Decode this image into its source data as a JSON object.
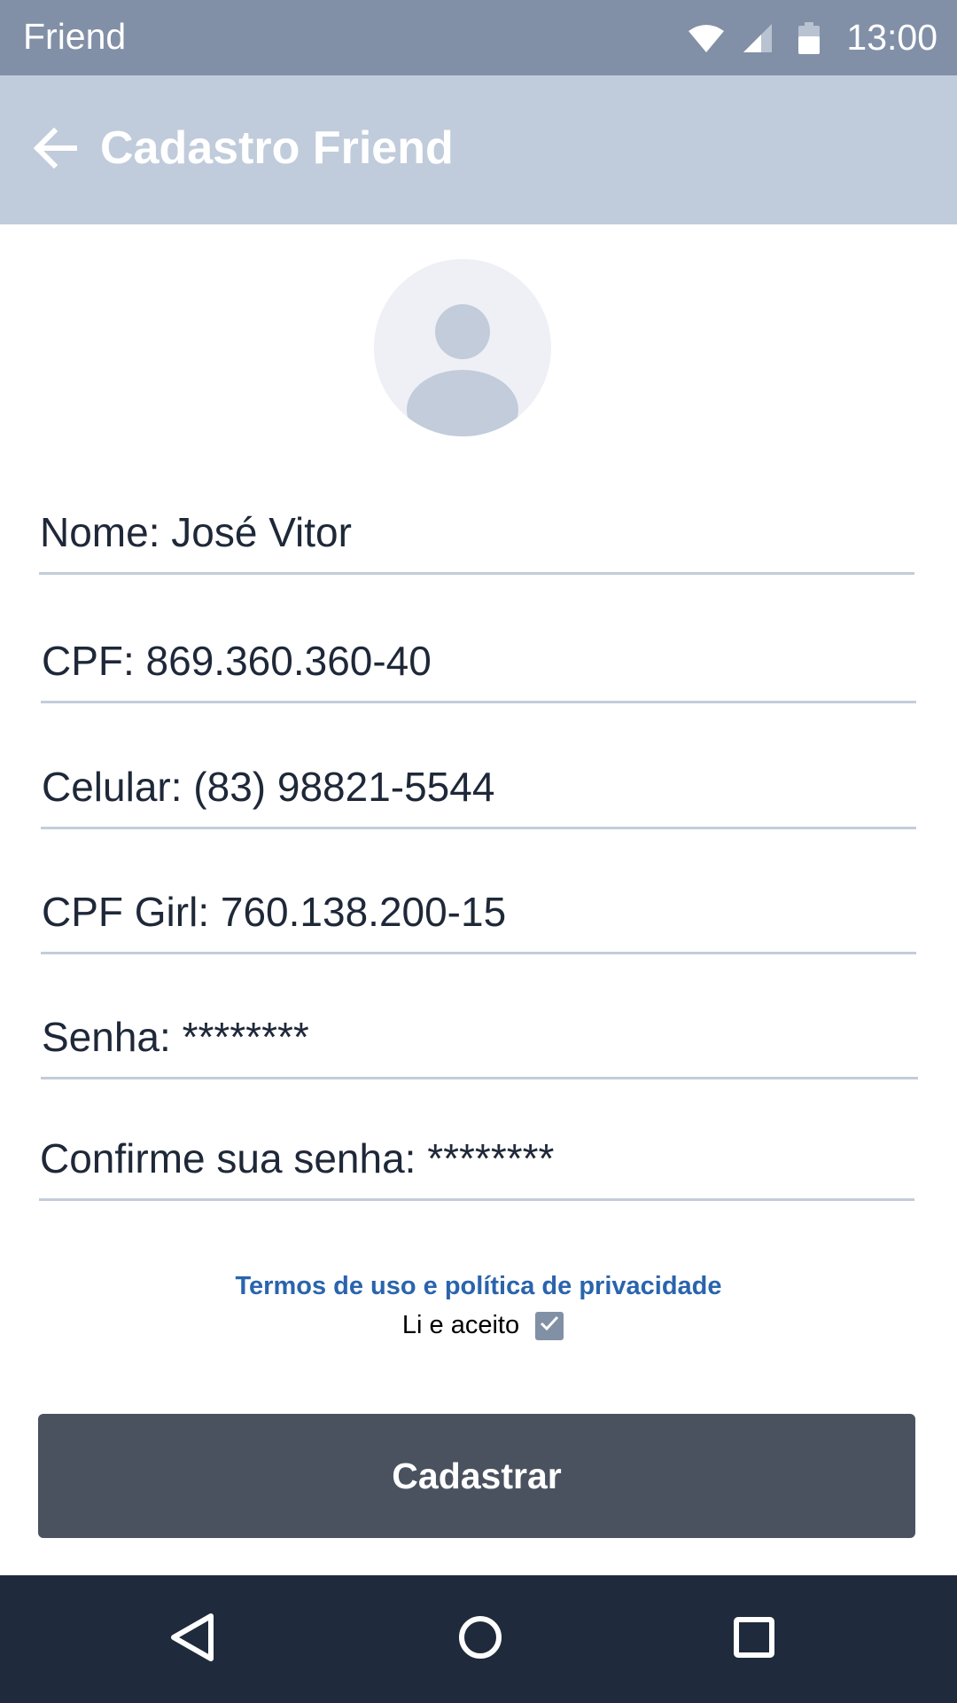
{
  "status_bar": {
    "app_name": "Friend",
    "time": "13:00",
    "icons": [
      "wifi-icon",
      "cell-signal-icon",
      "battery-icon"
    ]
  },
  "app_bar": {
    "title": "Cadastro Friend",
    "back_icon": "arrow-left-icon"
  },
  "avatar": {
    "icon": "person-placeholder-icon"
  },
  "form": {
    "nome": "Nome: José Vitor",
    "cpf": "CPF: 869.360.360-40",
    "celular": "Celular: (83) 98821-5544",
    "cpf_girl": "CPF Girl: 760.138.200-15",
    "senha": "Senha: ********",
    "confirme_senha": "Confirme sua senha: ********"
  },
  "terms": {
    "link_text": "Termos de uso e política de privacidade",
    "accept_label": "Li e aceito",
    "accepted": true
  },
  "submit": {
    "label": "Cadastrar"
  },
  "nav_bar": {
    "icons": [
      "nav-back-icon",
      "nav-home-icon",
      "nav-recents-icon"
    ]
  },
  "colors": {
    "status_bar": "#8190a7",
    "app_bar": "#c0ccdb",
    "link": "#2a64ad",
    "button": "#4a5260",
    "nav_bar": "#1f2b3c",
    "field_underline": "#c3ccd9"
  }
}
